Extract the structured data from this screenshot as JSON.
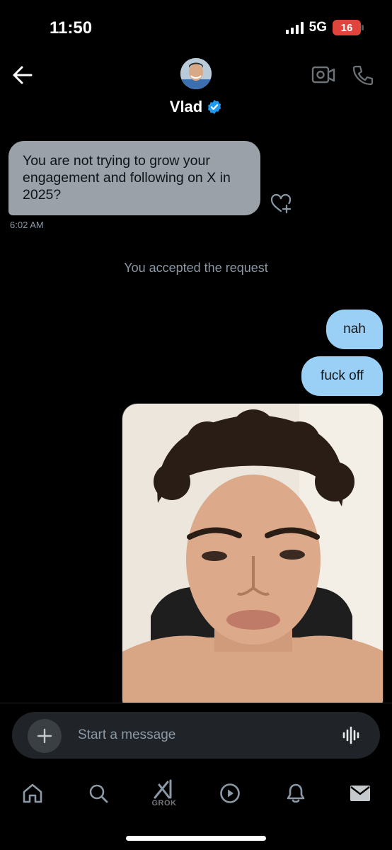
{
  "status_bar": {
    "time": "11:50",
    "network": "5G",
    "battery": "16"
  },
  "header": {
    "contact_name": "Vlad"
  },
  "messages": {
    "incoming_text": "You are not trying to grow your engagement and following on X in 2025?",
    "incoming_time": "6:02 AM",
    "system_notice": "You accepted the request",
    "outgoing": [
      "nah",
      "fuck off"
    ]
  },
  "composer": {
    "placeholder": "Start a message"
  },
  "nav": {
    "grok_label": "GROK"
  },
  "colors": {
    "background": "#000000",
    "incoming_bubble": "#9aa1a8",
    "outgoing_bubble": "#9ad0f5",
    "verified_badge": "#1d9bf0",
    "battery_low": "#e0443c"
  },
  "icons": [
    "back-arrow-icon",
    "verified-badge-icon",
    "video-call-icon",
    "phone-icon",
    "heart-plus-icon",
    "add-icon",
    "voice-message-icon",
    "home-icon",
    "search-icon",
    "grok-icon",
    "video-icon",
    "notifications-icon",
    "messages-icon"
  ]
}
